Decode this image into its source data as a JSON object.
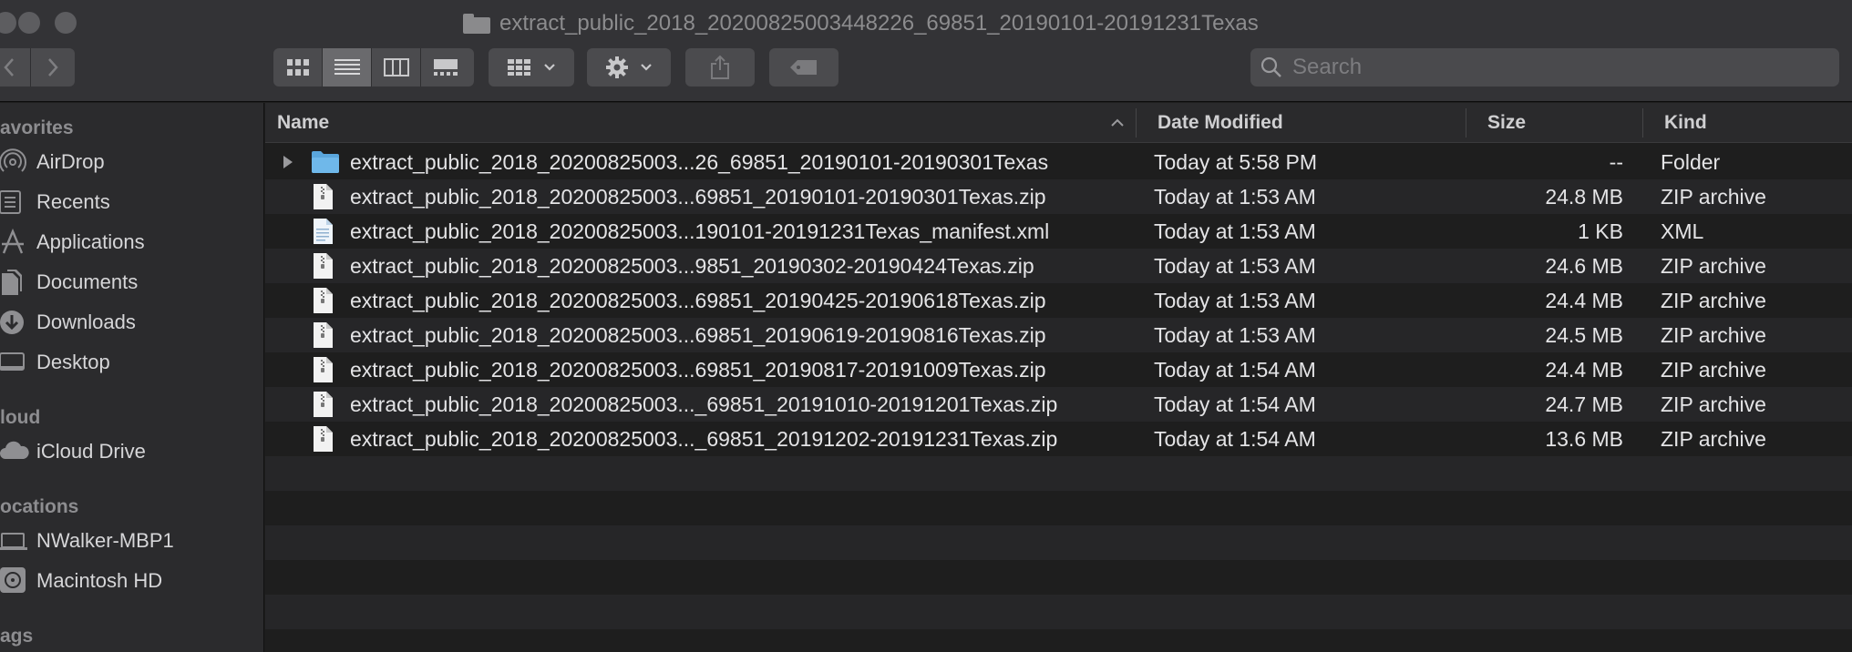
{
  "window": {
    "title": "extract_public_2018_20200825003448226_69851_20190101-20191231Texas"
  },
  "toolbar": {
    "search_placeholder": "Search"
  },
  "sidebar": {
    "sections": [
      {
        "header": "avorites",
        "items": [
          {
            "label": "AirDrop",
            "icon": "airdrop-icon"
          },
          {
            "label": "Recents",
            "icon": "recents-icon"
          },
          {
            "label": "Applications",
            "icon": "applications-icon"
          },
          {
            "label": "Documents",
            "icon": "documents-icon"
          },
          {
            "label": "Downloads",
            "icon": "downloads-icon"
          },
          {
            "label": "Desktop",
            "icon": "desktop-icon"
          }
        ]
      },
      {
        "header": "loud",
        "items": [
          {
            "label": "iCloud Drive",
            "icon": "cloud-icon"
          }
        ]
      },
      {
        "header": "ocations",
        "items": [
          {
            "label": "NWalker-MBP1",
            "icon": "laptop-icon"
          },
          {
            "label": "Macintosh HD",
            "icon": "disk-icon"
          }
        ]
      },
      {
        "header": "ags",
        "items": []
      }
    ]
  },
  "columns": {
    "name": "Name",
    "date": "Date Modified",
    "size": "Size",
    "kind": "Kind"
  },
  "files": [
    {
      "name": "extract_public_2018_20200825003...26_69851_20190101-20190301Texas",
      "date": "Today at 5:58 PM",
      "size": "--",
      "kind": "Folder",
      "type": "folder"
    },
    {
      "name": "extract_public_2018_20200825003...69851_20190101-20190301Texas.zip",
      "date": "Today at 1:53 AM",
      "size": "24.8 MB",
      "kind": "ZIP archive",
      "type": "zip"
    },
    {
      "name": "extract_public_2018_20200825003...190101-20191231Texas_manifest.xml",
      "date": "Today at 1:53 AM",
      "size": "1 KB",
      "kind": "XML",
      "type": "xml"
    },
    {
      "name": "extract_public_2018_20200825003...9851_20190302-20190424Texas.zip",
      "date": "Today at 1:53 AM",
      "size": "24.6 MB",
      "kind": "ZIP archive",
      "type": "zip"
    },
    {
      "name": "extract_public_2018_20200825003...69851_20190425-20190618Texas.zip",
      "date": "Today at 1:53 AM",
      "size": "24.4 MB",
      "kind": "ZIP archive",
      "type": "zip"
    },
    {
      "name": "extract_public_2018_20200825003...69851_20190619-20190816Texas.zip",
      "date": "Today at 1:53 AM",
      "size": "24.5 MB",
      "kind": "ZIP archive",
      "type": "zip"
    },
    {
      "name": "extract_public_2018_20200825003...69851_20190817-20191009Texas.zip",
      "date": "Today at 1:54 AM",
      "size": "24.4 MB",
      "kind": "ZIP archive",
      "type": "zip"
    },
    {
      "name": "extract_public_2018_20200825003..._69851_20191010-20191201Texas.zip",
      "date": "Today at 1:54 AM",
      "size": "24.7 MB",
      "kind": "ZIP archive",
      "type": "zip"
    },
    {
      "name": "extract_public_2018_20200825003..._69851_20191202-20191231Texas.zip",
      "date": "Today at 1:54 AM",
      "size": "13.6 MB",
      "kind": "ZIP archive",
      "type": "zip"
    }
  ]
}
